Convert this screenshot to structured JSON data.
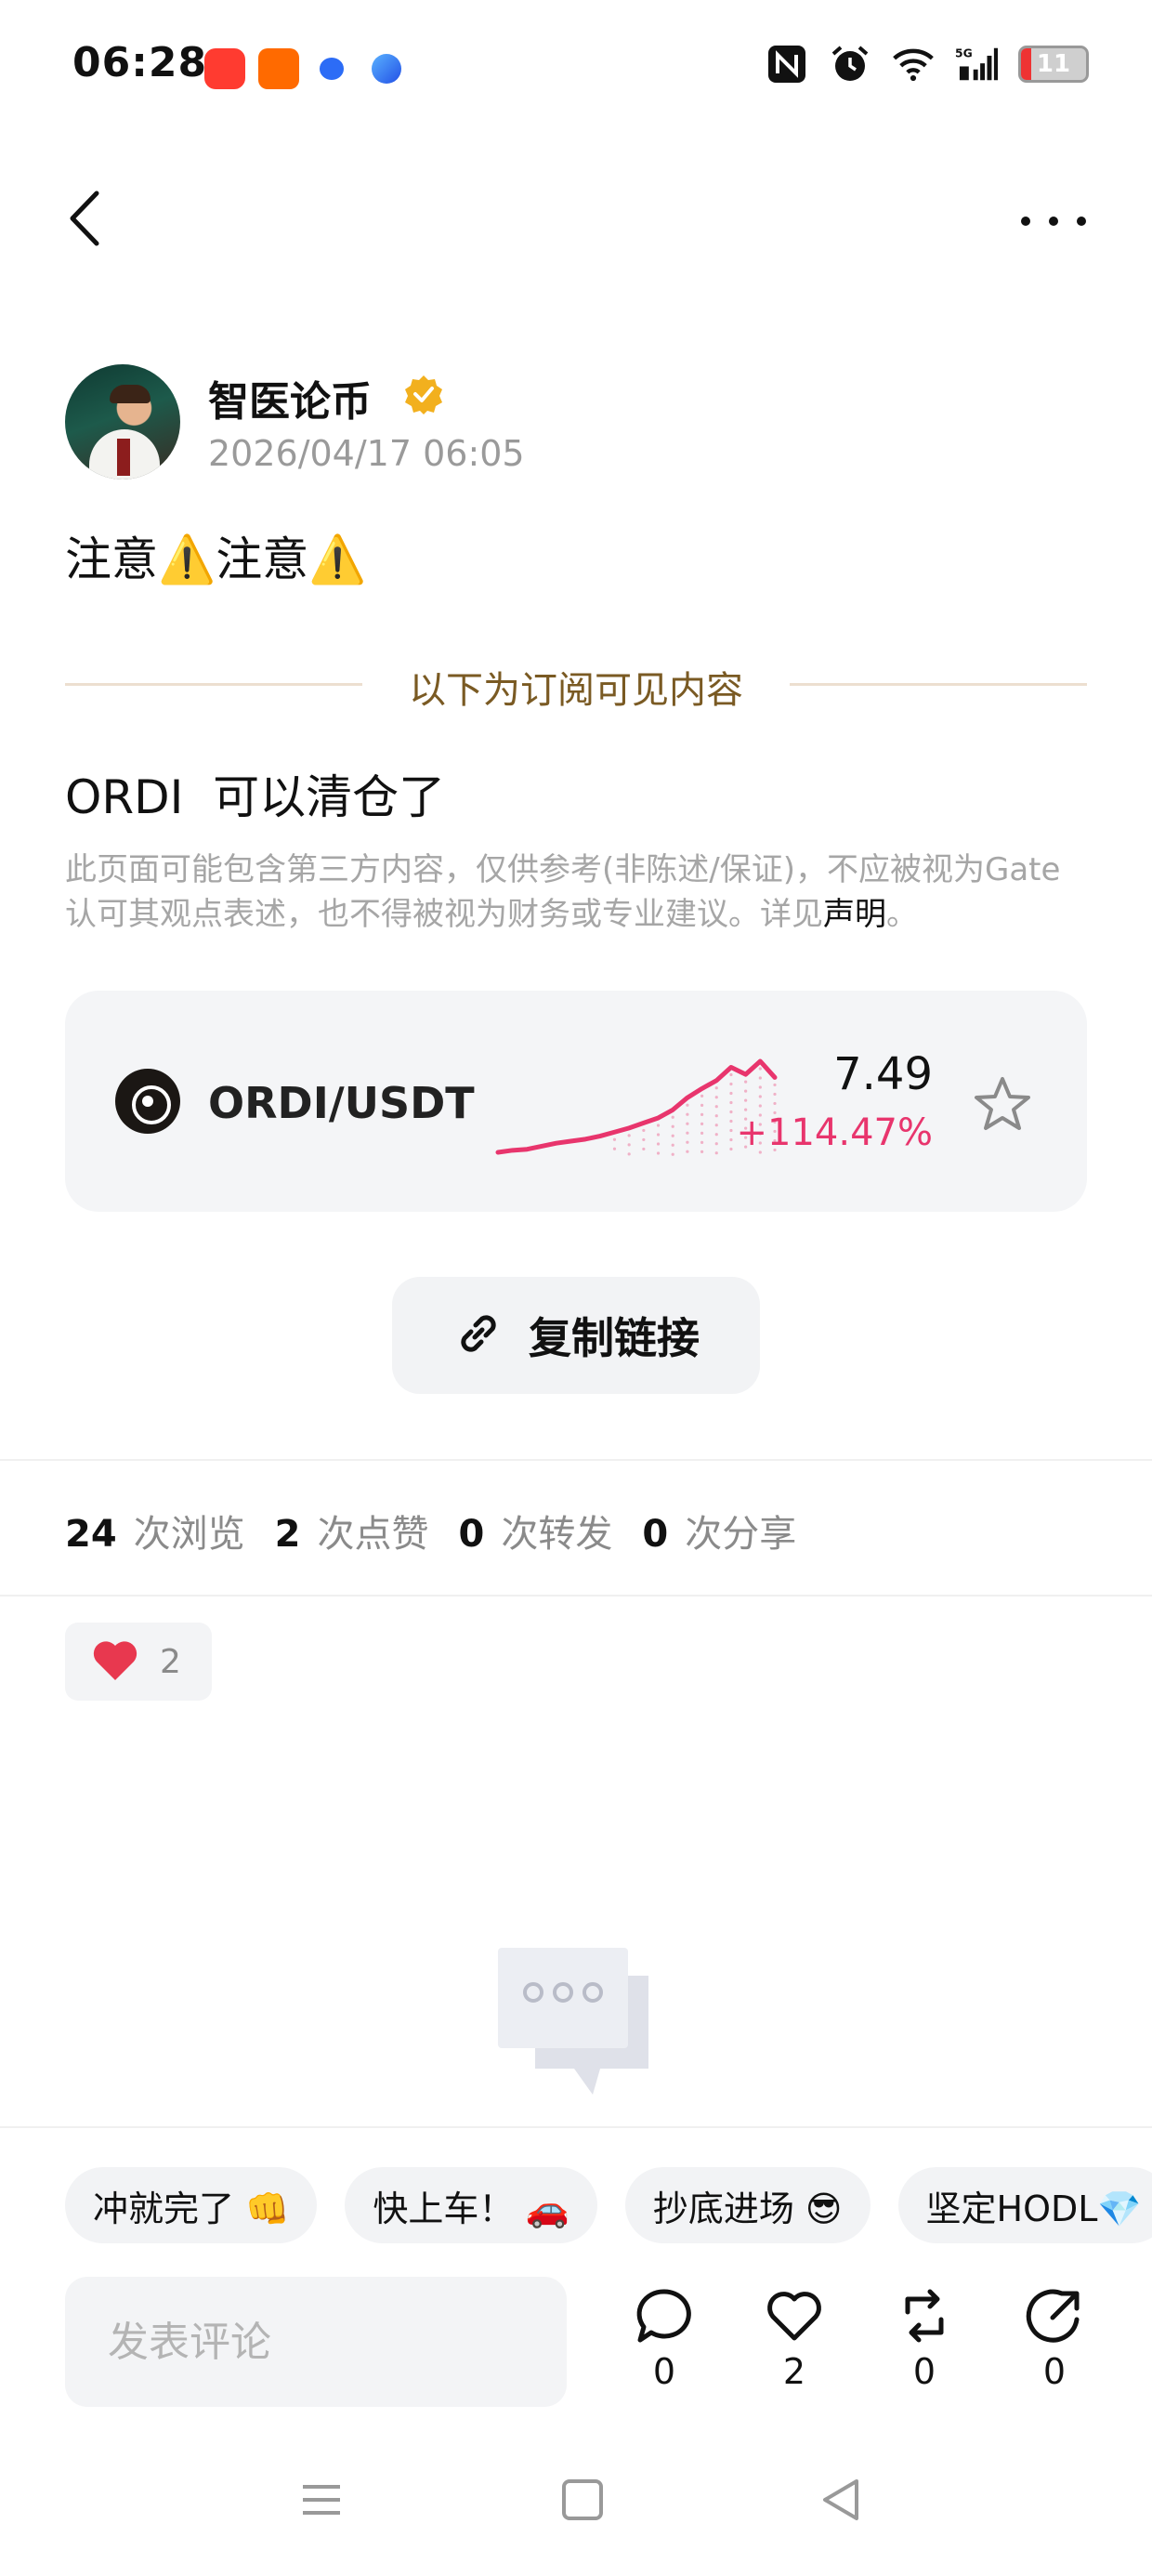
{
  "status_bar": {
    "time": "06:28",
    "battery_level": "11",
    "notification_icons": [
      "app-notification-icon",
      "app-notification-icon",
      "baidu-icon",
      "browser-icon"
    ],
    "system_icons": [
      "nfc-icon",
      "alarm-icon",
      "wifi-icon",
      "cellular-5g-icon",
      "battery-icon"
    ]
  },
  "nav": {
    "back_icon": "back-arrow-icon",
    "more_icon": "more-dots-icon"
  },
  "author": {
    "name": "智医论币",
    "badge": "verified-badge-icon",
    "time": "2026/04/17 06:05"
  },
  "post": {
    "title": "注意⚠️注意⚠️",
    "subscriber_divider": "以下为订阅可见内容",
    "content": "ORDI  可以清仓了",
    "disclaimer": "此页面可能包含第三方内容，仅供参考(非陈述/保证)，不应被视为Gate认可其观点表述，也不得被视为财务或专业建议。详见",
    "disclaimer_link": "声明",
    "disclaimer_end": "。"
  },
  "market_card": {
    "pair": "ORDI/USDT",
    "price": "7.49",
    "change": "+114.47%",
    "change_color": "#e8356d",
    "sparkline_trend": [
      1,
      1.2,
      1.3,
      1.6,
      1.9,
      2.1,
      2.3,
      2.6,
      3.0,
      3.4,
      3.9,
      4.4,
      5.2,
      6.4,
      7.3,
      8.1,
      9.4,
      8.7,
      10,
      8.4
    ],
    "star_icon": "star-outline-icon"
  },
  "copy_link": {
    "label": "复制链接",
    "icon": "link-icon"
  },
  "stats": [
    {
      "num": "24",
      "label": "次浏览"
    },
    {
      "num": "2",
      "label": "次点赞"
    },
    {
      "num": "0",
      "label": "次转发"
    },
    {
      "num": "0",
      "label": "次分享"
    }
  ],
  "reaction": {
    "icon": "heart-icon",
    "count": "2",
    "color": "#e8384f"
  },
  "quick_replies": [
    "冲就完了 👊",
    "快上车！ 🚗",
    "抄底进场 😎",
    "坚定HODL💎"
  ],
  "comment_bar": {
    "placeholder": "发表评论",
    "actions": [
      {
        "name": "comment",
        "icon": "comment-bubble-icon",
        "count": "0"
      },
      {
        "name": "like",
        "icon": "heart-outline-icon",
        "count": "2"
      },
      {
        "name": "repost",
        "icon": "repost-icon",
        "count": "0"
      },
      {
        "name": "share",
        "icon": "share-icon",
        "count": "0"
      }
    ]
  },
  "system_nav": [
    "menu-icon",
    "home-square-icon",
    "back-triangle-icon"
  ]
}
